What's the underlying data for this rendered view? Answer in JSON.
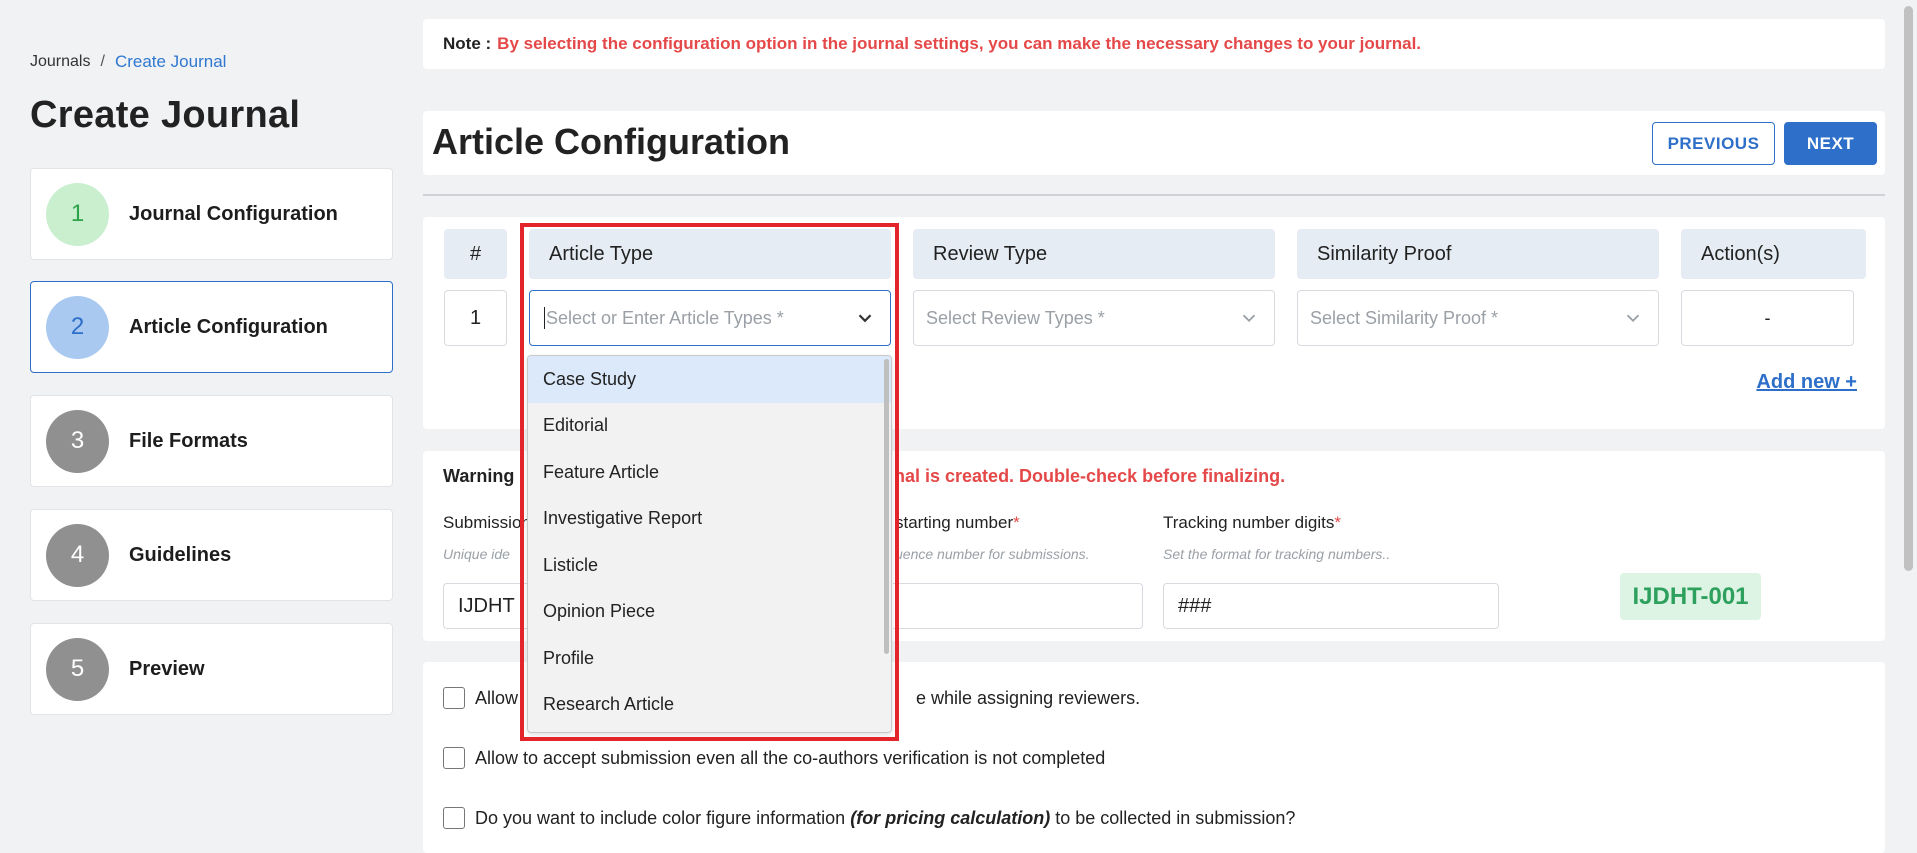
{
  "breadcrumb": {
    "root": "Journals",
    "separator": "/",
    "current": "Create Journal"
  },
  "page_title": "Create Journal",
  "steps": [
    {
      "number": "1",
      "label": "Journal Configuration",
      "circle_color": "#c9efcf",
      "number_color": "#2ea34a"
    },
    {
      "number": "2",
      "label": "Article Configuration",
      "circle_color": "#a9c9f0",
      "number_color": "#2d6fc9"
    },
    {
      "number": "3",
      "label": "File Formats",
      "circle_color": "#909090",
      "number_color": "#ffffff"
    },
    {
      "number": "4",
      "label": "Guidelines",
      "circle_color": "#909090",
      "number_color": "#ffffff"
    },
    {
      "number": "5",
      "label": "Preview",
      "circle_color": "#909090",
      "number_color": "#ffffff"
    }
  ],
  "note": {
    "label": "Note :",
    "text": "By selecting the configuration option in the journal settings, you can make the necessary changes to your journal."
  },
  "section_title": "Article Configuration",
  "buttons": {
    "previous": "PREVIOUS",
    "next": "NEXT"
  },
  "table": {
    "headers": {
      "num": "#",
      "article_type": "Article Type",
      "review_type": "Review Type",
      "similarity": "Similarity Proof",
      "actions": "Action(s)"
    },
    "row": {
      "num": "1",
      "article_type_placeholder": "Select or Enter Article Types *",
      "review_type_placeholder": "Select Review Types *",
      "similarity_placeholder": "Select Similarity Proof *",
      "action": "-"
    },
    "add_new": "Add new +"
  },
  "dropdown_options": [
    "Case Study",
    "Editorial",
    "Feature Article",
    "Investigative Report",
    "Listicle",
    "Opinion Piece",
    "Profile",
    "Research Article"
  ],
  "warning": {
    "label": "Warning",
    "text": "nal is created. Double-check before finalizing."
  },
  "fields": {
    "submission_label": "Submission",
    "submission_hint": "Unique ide",
    "submission_value": "IJDHT",
    "starting_label": "starting number",
    "starting_hint": "uence number for submissions.",
    "digits_label": "Tracking number digits",
    "digits_hint": "Set the format for tracking numbers..",
    "digits_value": "###",
    "required_mark": "*"
  },
  "preview_badge": "IJDHT-001",
  "options": [
    {
      "pre": "Allow",
      "post": "e while assigning reviewers."
    },
    {
      "text": "Allow to accept submission even all the co-authors verification is not completed"
    },
    {
      "pre": "Do you want to include color figure information ",
      "em": "(for pricing calculation)",
      "post": " to be collected in submission?"
    }
  ],
  "colors": {
    "accent": "#2d6fc9",
    "warning": "#e54848",
    "highlight": "#e3242b",
    "success": "#2ea05d"
  }
}
